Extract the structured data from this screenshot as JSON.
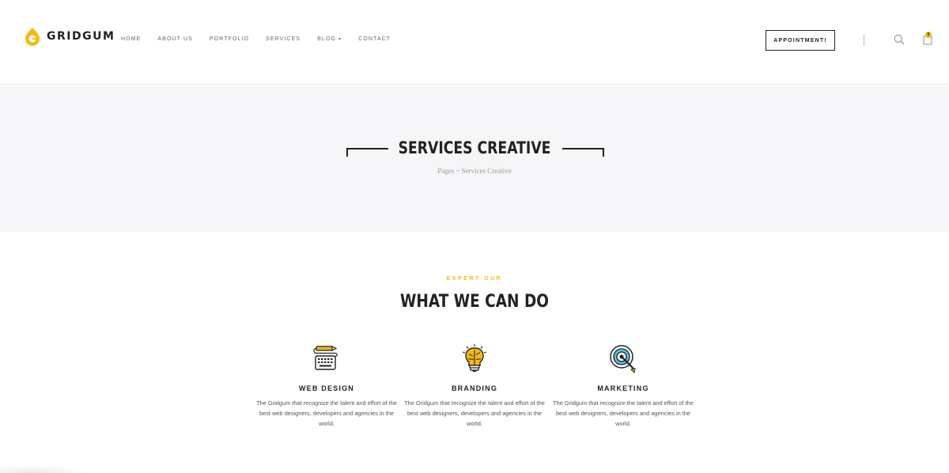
{
  "brand": {
    "name": "GRIDGUM",
    "accent": "#f5b915"
  },
  "nav": {
    "items": [
      {
        "label": "HOME"
      },
      {
        "label": "ABOUT US"
      },
      {
        "label": "PORTFOLIO"
      },
      {
        "label": "SERVICES"
      },
      {
        "label": "BLOG",
        "has_dropdown": true
      },
      {
        "label": "CONTACT"
      }
    ],
    "appointment_label": "APPOINTMENT!",
    "cart_count": "0",
    "icons": [
      "search-icon",
      "cart-icon",
      "chevron-down-icon"
    ]
  },
  "hero": {
    "title": "SERVICES CREATIVE",
    "breadcrumb": "Pages ~ Services Creative",
    "background": "#f6f6f8"
  },
  "services_section": {
    "eyebrow": "EXPERT OUR",
    "title": "WHAT WE CAN DO",
    "items": [
      {
        "icon": "keyboard-pencil-icon",
        "title": "WEB DESIGN",
        "description": "The Gridgum that recognize the talent and effort of the best web designers, developers and agencies in the world."
      },
      {
        "icon": "lightbulb-brain-icon",
        "title": "BRANDING",
        "description": "The Gridgum that recognize the talent and effort of the best web designers, developers and agencies in the world."
      },
      {
        "icon": "target-icon",
        "title": "MARKETING",
        "description": "The Gridgum that recognize the talent and effort of the best web designers, developers and agencies in the world."
      }
    ]
  }
}
